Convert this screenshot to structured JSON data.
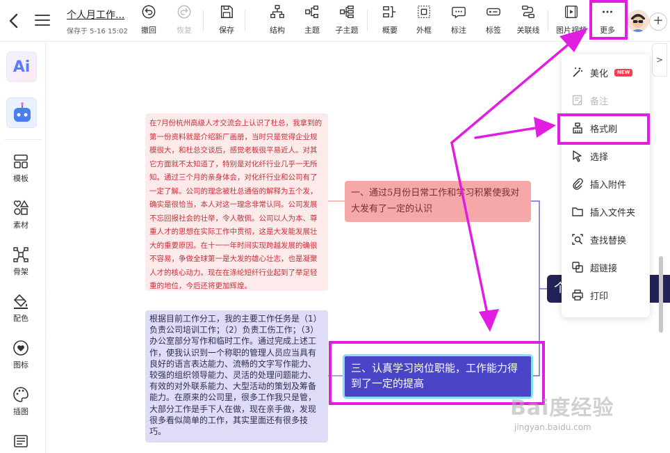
{
  "toolbar": {
    "doc_title": "个人月工作...",
    "saved_text": "保存于 5-16 15:02",
    "undo": "撤回",
    "redo": "恢复",
    "save": "保存",
    "structure": "结构",
    "topic": "主题",
    "subtopic": "子主题",
    "summary": "概要",
    "boundary": "外框",
    "callout": "标注",
    "label": "标签",
    "relation": "关联线",
    "image_video": "图片视频",
    "more": "更多"
  },
  "sidebar": {
    "ai_text": "Ai",
    "items": [
      {
        "label": "模板",
        "icon": "template-icon"
      },
      {
        "label": "素材",
        "icon": "shapes-icon"
      },
      {
        "label": "骨架",
        "icon": "skeleton-icon"
      },
      {
        "label": "配色",
        "icon": "paint-bucket-icon"
      },
      {
        "label": "图标",
        "icon": "heart-icon"
      },
      {
        "label": "插图",
        "icon": "palette-icon"
      },
      {
        "label": "",
        "icon": "image-icon"
      }
    ]
  },
  "canvas": {
    "note_red": "在7月份杭州高级人才交流会上认识了杜总，我拿到的第一份资料就是介绍新厂画册，当时只是觉得企业规模很大，和杜总交谈后，感觉老板很平易近人。对其它方面就不太知道了，特别是对化纤行业几乎一无所知。通过三个月的亲身体会，对化纤行业和公司有了一定了解。公司的理念被杜总通俗的解释为五个发，确实是很恰当，本人对这一理念非常认同。公司发展不忘回报社会的壮举，令人敬佩。公司以人为本、尊重人才的思想在实际工作中贯彻，这是大发能发展壮大的重要原因。在十一一年时间实现跨越发展的确很不容易，争做全球第一是大发的雄心壮志，也是凝聚人才的核心动力。现在在涤纶短纤行业起到了举足轻重的地位，今后还将更加辉煌。",
    "note_purple": "根据目前工作分工，我的主要工作任务是（1）负责公司培训工作；（2）负责工伤工作；（3）办公室部分写作和临时工作。通过完成上述工作，使我认识到一个称职的管理人员应当具有良好的语言表达能力、流畅的文字写作能力、较强的组织领导能力、灵活的处理问题能力、有效的对外联系能力、大型活动的策划及筹备能力。在原来的公司里，很多工作我只是管，大部分工作是手下人在做，现在亲手做，发现很多看似简单的工作，其实里面还有很多技巧。",
    "topic_1": "一、通过5月份日常工作和学习积累使我对大发有了一定的认识",
    "topic_3": "三、认真学习岗位职能，工作能力得到了一定的提高",
    "central_topic": "个人月工作总结"
  },
  "more_menu": {
    "items": [
      {
        "label": "美化",
        "icon": "magic-wand-icon",
        "badge": "NEW",
        "disabled": false
      },
      {
        "label": "备注",
        "icon": "note-icon",
        "disabled": true
      },
      {
        "label": "格式刷",
        "icon": "format-brush-icon",
        "disabled": false
      },
      {
        "label": "选择",
        "icon": "cursor-icon",
        "disabled": false
      },
      {
        "label": "插入附件",
        "icon": "paperclip-icon",
        "disabled": false
      },
      {
        "label": "插入文件夹",
        "icon": "folder-icon",
        "disabled": false
      },
      {
        "label": "查找替换",
        "icon": "find-replace-icon",
        "disabled": false
      },
      {
        "label": "超链接",
        "icon": "link-icon",
        "disabled": false
      },
      {
        "label": "打印",
        "icon": "printer-icon",
        "disabled": false
      }
    ]
  },
  "watermark": {
    "logo": "Bai度经验",
    "url": "jingyan.baidu.com"
  },
  "colors": {
    "highlight": "#e21de2",
    "topic_blue": "#4a44c6",
    "topic_pink": "#f6a7a7",
    "note_red_bg": "#fdeaea",
    "note_red_text": "#c9303a",
    "note_purple_bg": "#dedcf7",
    "central": "#23235a"
  }
}
